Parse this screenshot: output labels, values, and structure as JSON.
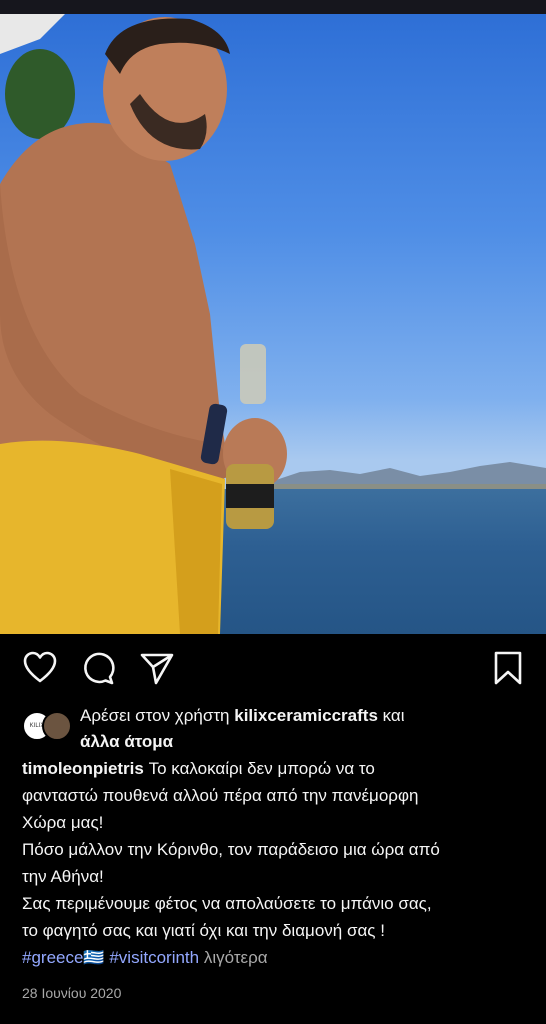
{
  "post": {
    "image_icon": "photo-man-by-sea",
    "actions": {
      "like_icon": "heart-icon",
      "comment_icon": "comment-icon",
      "share_icon": "send-icon",
      "save_icon": "bookmark-icon"
    },
    "likes": {
      "prefix": "Αρέσει στον χρήστη",
      "user": "kilixceramiccrafts",
      "middle": "και",
      "suffix": "άλλα άτομα",
      "avatar_label": "KILIX"
    },
    "caption": {
      "username": "timoleonpietris",
      "line1": "Το καλοκαίρι δεν μπορώ να το",
      "line2": "φανταστώ πουθενά αλλού πέρα από την πανέμορφη",
      "line3": "Χώρα μας!",
      "line4": "Πόσο μάλλον την Κόρινθο, τον παράδεισο μια ώρα από",
      "line5": "την Αθήνα!",
      "line6": "Σας περιμένουμε φέτος να απολαύσετε το μπάνιο σας,",
      "line7": "το φαγητό σας και γιατί όχι και την διαμονή σας !",
      "tag1": "#greece🇬🇷",
      "tag2": "#visitcorinth",
      "more": "λιγότερα"
    },
    "date": "28 Ιουνίου 2020"
  },
  "colors": {
    "background": "#000000",
    "hashtag": "#93a8ff",
    "muted": "#a8a8a8"
  }
}
